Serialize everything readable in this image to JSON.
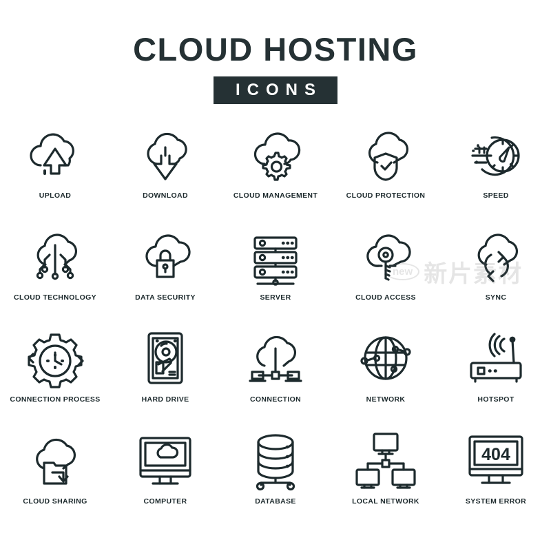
{
  "header": {
    "title": "CLOUD HOSTING",
    "badge": "ICONS"
  },
  "watermark": {
    "mark": "new",
    "text": "新片素材"
  },
  "colors": {
    "stroke": "#1d2a2d",
    "badge_background": "#253134",
    "badge_text": "#ffffff",
    "page_background": "#ffffff",
    "label_text": "#1d2a2d"
  },
  "grid": {
    "columns": 5,
    "rows": 4,
    "icons": [
      {
        "label": "UPLOAD",
        "icon": "cloud-upload-icon"
      },
      {
        "label": "DOWNLOAD",
        "icon": "cloud-download-icon"
      },
      {
        "label": "CLOUD MANAGEMENT",
        "icon": "cloud-gear-icon"
      },
      {
        "label": "CLOUD PROTECTION",
        "icon": "cloud-shield-check-icon"
      },
      {
        "label": "SPEED",
        "icon": "speedometer-icon"
      },
      {
        "label": "CLOUD TECHNOLOGY",
        "icon": "cloud-circuit-icon"
      },
      {
        "label": "DATA SECURITY",
        "icon": "cloud-lock-icon"
      },
      {
        "label": "SERVER",
        "icon": "server-rack-icon"
      },
      {
        "label": "CLOUD ACCESS",
        "icon": "cloud-key-icon"
      },
      {
        "label": "SYNC",
        "icon": "cloud-sync-arrows-icon"
      },
      {
        "label": "CONNECTION PROCESS",
        "icon": "gear-clock-icon"
      },
      {
        "label": "HARD DRIVE",
        "icon": "hard-drive-icon"
      },
      {
        "label": "CONNECTION",
        "icon": "cloud-connection-icon"
      },
      {
        "label": "NETWORK",
        "icon": "globe-network-icon"
      },
      {
        "label": "HOTSPOT",
        "icon": "router-hotspot-icon"
      },
      {
        "label": "CLOUD SHARING",
        "icon": "cloud-folder-share-icon"
      },
      {
        "label": "COMPUTER",
        "icon": "monitor-cloud-icon"
      },
      {
        "label": "DATABASE",
        "icon": "database-icon"
      },
      {
        "label": "LOCAL NETWORK",
        "icon": "local-network-icon"
      },
      {
        "label": "SYSTEM ERROR",
        "icon": "monitor-404-icon"
      }
    ],
    "error_code": "404"
  }
}
